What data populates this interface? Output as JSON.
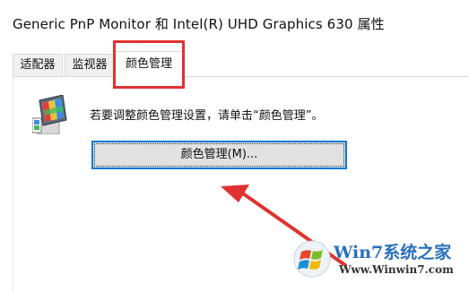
{
  "window": {
    "title": "Generic PnP Monitor 和 Intel(R) UHD Graphics 630 属性"
  },
  "tabs": [
    {
      "label": "适配器"
    },
    {
      "label": "监视器"
    },
    {
      "label": "颜色管理",
      "selected": true
    }
  ],
  "panel": {
    "icon": "color-management-monitor-icon",
    "instruction": "若要调整颜色管理设置，请单击“颜色管理”。",
    "button_label": "颜色管理(M)..."
  },
  "annotations": {
    "highlight_color": "#e03232",
    "arrow_color": "#e03232"
  },
  "watermark": {
    "brand": "Win7系统之家",
    "url": "Www.Winwin7.com"
  }
}
